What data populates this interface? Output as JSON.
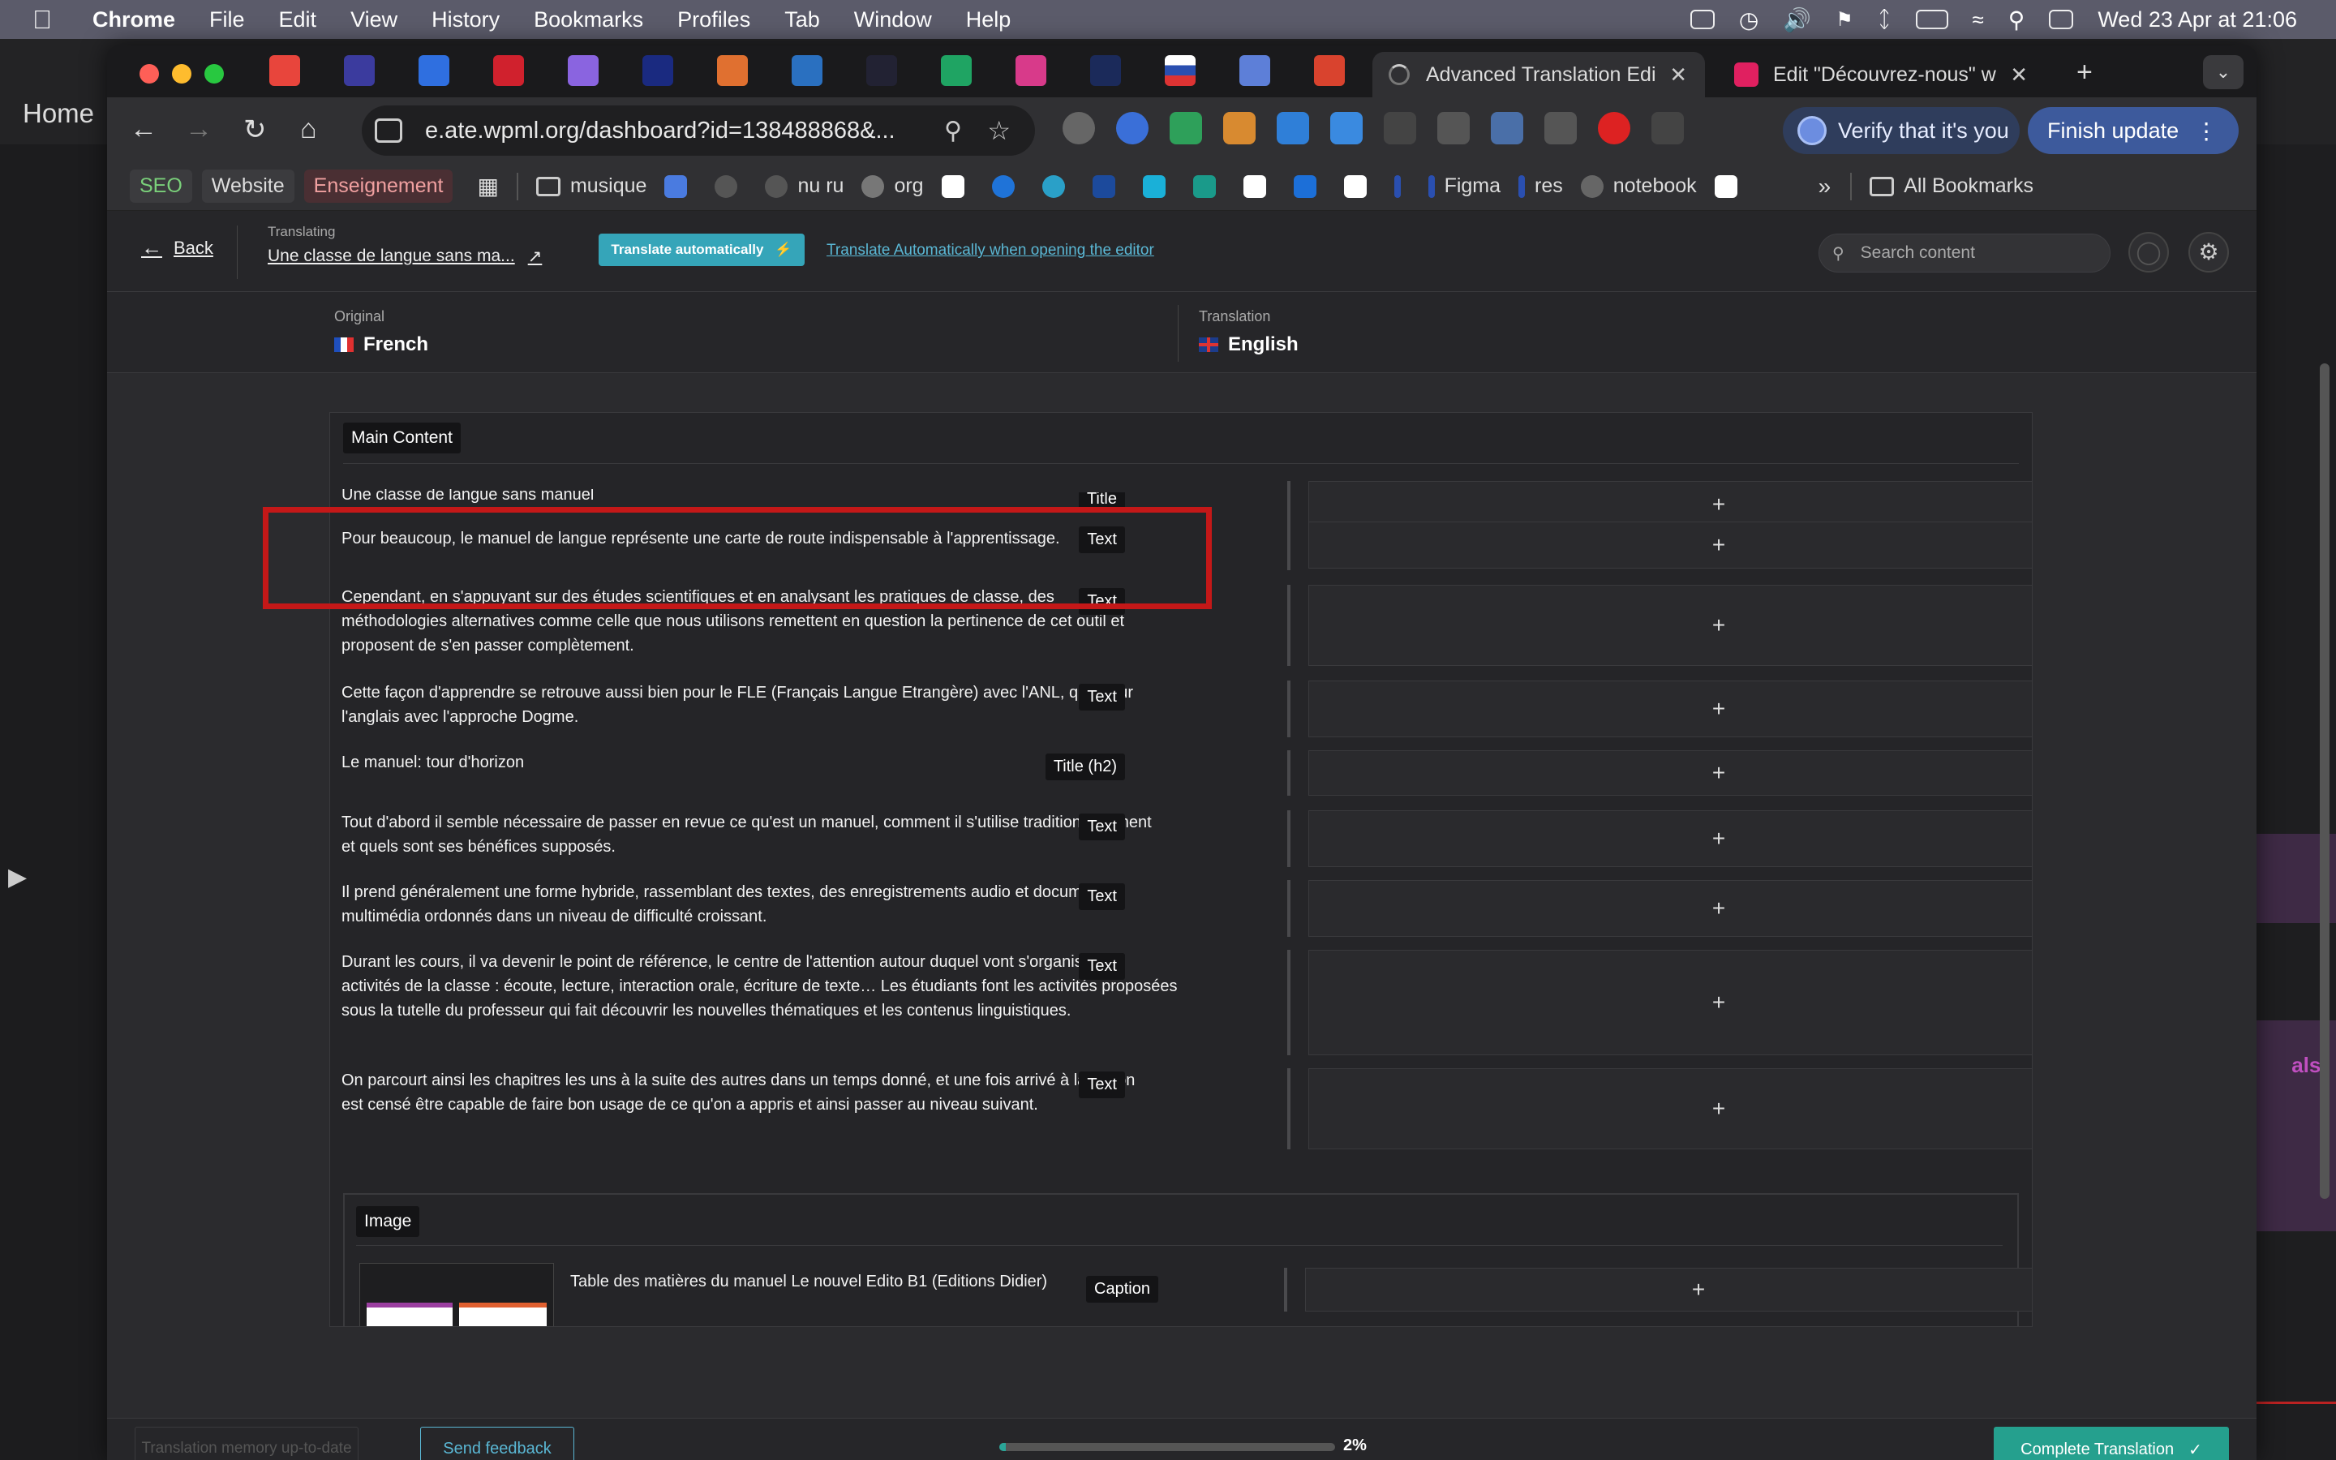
{
  "menubar": {
    "app": "Chrome",
    "items": [
      "File",
      "Edit",
      "View",
      "History",
      "Bookmarks",
      "Profiles",
      "Tab",
      "Window",
      "Help"
    ],
    "datetime": "Wed 23 Apr at  21:06"
  },
  "background_app": {
    "home_label": "Home",
    "sidebar_text": "als-"
  },
  "tabs": {
    "active_title": "Advanced Translation Edi",
    "second_title": "Edit \"Découvrez-nous\" w",
    "new_tab": "+"
  },
  "toolbar": {
    "url": "e.ate.wpml.org/dashboard?id=138488868&...",
    "verify_label": "Verify that it's you",
    "finish_label": "Finish update"
  },
  "bookmarks": {
    "chips": [
      "SEO",
      "Website",
      "Enseignement"
    ],
    "items": [
      "musique",
      "nu ru",
      "org",
      "Figma",
      "res",
      "notebook"
    ],
    "all_label": "All Bookmarks"
  },
  "editor": {
    "back_label": "Back",
    "translating_label": "Translating",
    "doc_title": "Une classe de langue sans ma...",
    "auto_btn": "Translate automatically",
    "auto_link": "Translate Automatically when opening the editor",
    "search_placeholder": "Search content",
    "original_label": "Original",
    "original_lang": "French",
    "translation_label": "Translation",
    "translation_lang": "English",
    "section_main": "Main Content",
    "rows": [
      {
        "text": "Une classe de langue sans manuel",
        "type": "Title"
      },
      {
        "text": "Pour beaucoup, le manuel de langue représente une carte de route indispensable à l'apprentissage.",
        "type": "Text"
      },
      {
        "text": "Cependant, en s'appuyant sur des études scientifiques et en analysant les pratiques de classe, des méthodologies alternatives comme celle que nous utilisons remettent en question la pertinence de cet outil et proposent de s'en passer complètement.",
        "type": "Text"
      },
      {
        "text": "Cette façon d'apprendre se retrouve aussi bien pour le FLE (Français Langue Etrangère) avec l'ANL, que pour l'anglais avec l'approche Dogme.",
        "type": "Text"
      },
      {
        "text": "Le manuel: tour d'horizon",
        "type": "Title (h2)"
      },
      {
        "text": "Tout d'abord il semble nécessaire de passer en revue ce qu'est un manuel, comment il s'utilise traditionnellement et quels sont ses bénéfices supposés.",
        "type": "Text"
      },
      {
        "text": "Il prend généralement une forme hybride, rassemblant des textes, des enregistrements audio et documents multimédia ordonnés dans un niveau de difficulté croissant.",
        "type": "Text"
      },
      {
        "text": "Durant les cours, il va devenir le point de référence, le centre de l'attention autour duquel vont s'organiser les activités de la classe : écoute, lecture, interaction orale, écriture de texte… Les étudiants font les activités proposées sous la tutelle du professeur qui fait découvrir les nouvelles thématiques et les contenus linguistiques.",
        "type": "Text"
      },
      {
        "text": "On parcourt ainsi les chapitres les uns à la suite des autres dans un temps donné, et une fois arrivé à la fin, on est censé être capable de faire bon usage de ce qu'on a appris et ainsi passer au niveau suivant.",
        "type": "Text"
      }
    ],
    "add_symbol": "+",
    "section_image": "Image",
    "caption_text": "Table des matières du manuel Le nouvel Edito B1 (Editions Didier)",
    "caption_type": "Caption",
    "tm_label": "Translation memory up-to-date",
    "feedback_label": "Send feedback",
    "progress": 2,
    "progress_text": "2%",
    "complete_label": "Complete Translation"
  }
}
